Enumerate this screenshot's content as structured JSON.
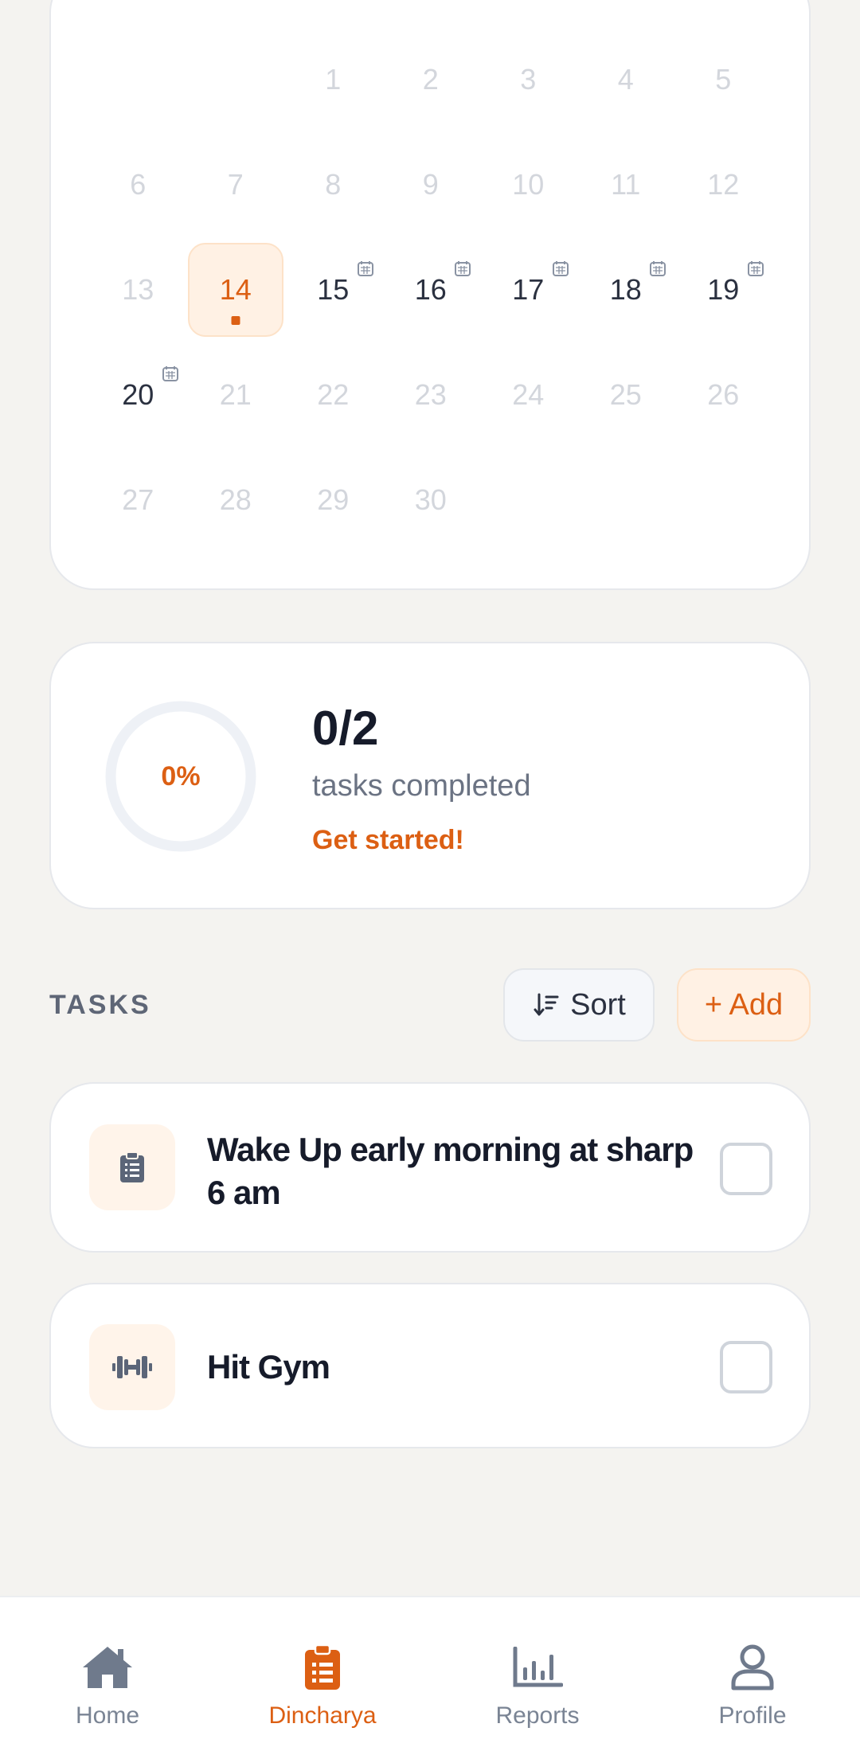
{
  "calendar": {
    "weeks": [
      [
        {
          "d": ""
        },
        {
          "d": ""
        },
        {
          "d": "1"
        },
        {
          "d": "2"
        },
        {
          "d": "3"
        },
        {
          "d": "4"
        },
        {
          "d": "5"
        }
      ],
      [
        {
          "d": "6"
        },
        {
          "d": "7"
        },
        {
          "d": "8"
        },
        {
          "d": "9"
        },
        {
          "d": "10"
        },
        {
          "d": "11"
        },
        {
          "d": "12"
        }
      ],
      [
        {
          "d": "13"
        },
        {
          "d": "14",
          "today": true
        },
        {
          "d": "15",
          "active": true,
          "event": true
        },
        {
          "d": "16",
          "active": true,
          "event": true
        },
        {
          "d": "17",
          "active": true,
          "event": true
        },
        {
          "d": "18",
          "active": true,
          "event": true
        },
        {
          "d": "19",
          "active": true,
          "event": true
        }
      ],
      [
        {
          "d": "20",
          "active": true,
          "event": true
        },
        {
          "d": "21"
        },
        {
          "d": "22"
        },
        {
          "d": "23"
        },
        {
          "d": "24"
        },
        {
          "d": "25"
        },
        {
          "d": "26"
        }
      ],
      [
        {
          "d": "27"
        },
        {
          "d": "28"
        },
        {
          "d": "29"
        },
        {
          "d": "30"
        },
        {
          "d": ""
        },
        {
          "d": ""
        },
        {
          "d": ""
        }
      ]
    ],
    "today_color": "#dc5f13"
  },
  "progress": {
    "percent_label": "0%",
    "percent": 0,
    "count": "0/2",
    "subtitle": "tasks completed",
    "encouragement": "Get started!"
  },
  "tasks": {
    "title": "TASKS",
    "sort_label": "Sort",
    "add_label": "+ Add",
    "items": [
      {
        "label": "Wake Up early morning at sharp 6 am",
        "icon": "clipboard-icon",
        "done": false
      },
      {
        "label": "Hit Gym",
        "icon": "dumbbell-icon",
        "done": false
      }
    ]
  },
  "nav": {
    "items": [
      {
        "label": "Home",
        "icon": "home-icon"
      },
      {
        "label": "Dincharya",
        "icon": "clipboard-list-icon",
        "active": true
      },
      {
        "label": "Reports",
        "icon": "bar-chart-icon"
      },
      {
        "label": "Profile",
        "icon": "user-icon"
      }
    ]
  },
  "colors": {
    "accent": "#dc5f13",
    "accent_soft": "#fff1e4",
    "muted": "#7a8494"
  }
}
